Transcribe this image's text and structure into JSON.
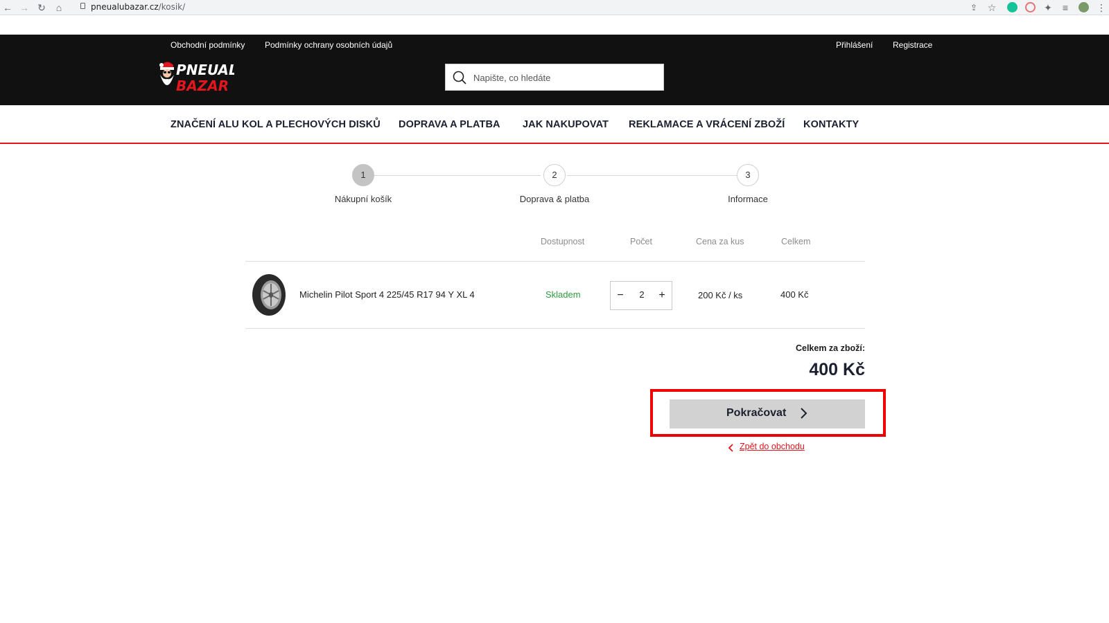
{
  "browser": {
    "url_host": "pneualubazar.cz",
    "url_path": "/kosik/"
  },
  "header": {
    "top_links": [
      "Obchodní podmínky",
      "Podmínky ochrany osobních údajů"
    ],
    "account_links": [
      "Přihlášení",
      "Registrace"
    ],
    "logo_text_top": "PNEUALU",
    "logo_text_bottom": "BAZAR",
    "search_placeholder": "Napište, co hledáte"
  },
  "nav": {
    "items": [
      "ZNAČENÍ ALU KOL A PLECHOVÝCH DISKŮ",
      "DOPRAVA A PLATBA",
      "JAK NAKUPOVAT",
      "REKLAMACE A VRÁCENÍ ZBOŽÍ",
      "KONTAKTY"
    ]
  },
  "steps": [
    {
      "number": "1",
      "label": "Nákupní košík",
      "active": true
    },
    {
      "number": "2",
      "label": "Doprava & platba",
      "active": false
    },
    {
      "number": "3",
      "label": "Informace",
      "active": false
    }
  ],
  "cart": {
    "columns": [
      "Dostupnost",
      "Počet",
      "Cena za kus",
      "Celkem"
    ],
    "items": [
      {
        "name": "Michelin Pilot Sport 4 225/45 R17 94 Y XL 4",
        "availability": "Skladem",
        "quantity": "2",
        "unit_price": "200 Kč / ks",
        "total": "400 Kč"
      }
    ],
    "qty_minus": "−",
    "qty_plus": "+"
  },
  "summary": {
    "label": "Celkem za zboží:",
    "value": "400 Kč",
    "continue_label": "Pokračovat",
    "back_label": "Zpět do obchodu"
  },
  "colors": {
    "header_bg": "#111111",
    "accent_red": "#e3161d",
    "in_stock_green": "#2e9b3e",
    "highlight_red": "#ec0000",
    "button_gray": "#d2d2d2"
  }
}
